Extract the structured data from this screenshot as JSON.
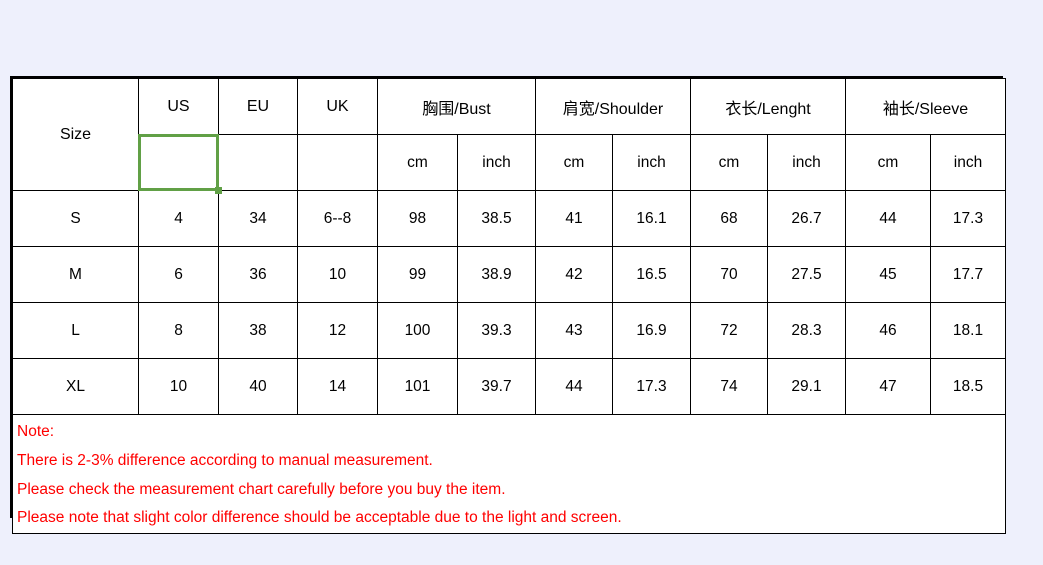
{
  "page": {
    "background_color": "#eef0fc",
    "table_border_color": "#000000",
    "selection_color": "#61a046",
    "note_color": "#ff0000"
  },
  "table": {
    "header_groups": [
      {
        "label": "Size",
        "span": 1
      },
      {
        "label": "US",
        "span": 1
      },
      {
        "label": "EU",
        "span": 1
      },
      {
        "label": "UK",
        "span": 1
      },
      {
        "label": "胸围/Bust",
        "span": 2
      },
      {
        "label": "肩宽/Shoulder",
        "span": 2
      },
      {
        "label": "衣长/Lenght",
        "span": 2
      },
      {
        "label": "袖长/Sleeve",
        "span": 2
      }
    ],
    "unit_row": {
      "size": "",
      "us": "",
      "eu": "",
      "uk": "",
      "bust_cm": "cm",
      "bust_inch": "inch",
      "shoulder_cm": "cm",
      "shoulder_inch": "inch",
      "length_cm": "cm",
      "length_inch": "inch",
      "sleeve_cm": "cm",
      "sleeve_inch": "inch"
    },
    "selected_cell": "us-unit-cell",
    "columns": [
      "Size",
      "US",
      "EU",
      "UK",
      "Bust cm",
      "Bust inch",
      "Shoulder cm",
      "Shoulder inch",
      "Length cm",
      "Length inch",
      "Sleeve cm",
      "Sleeve inch"
    ],
    "rows": [
      {
        "size": "S",
        "us": "4",
        "eu": "34",
        "uk": "6--8",
        "bust_cm": "98",
        "bust_inch": "38.5",
        "shoulder_cm": "41",
        "shoulder_inch": "16.1",
        "length_cm": "68",
        "length_inch": "26.7",
        "sleeve_cm": "44",
        "sleeve_inch": "17.3"
      },
      {
        "size": "M",
        "us": "6",
        "eu": "36",
        "uk": "10",
        "bust_cm": "99",
        "bust_inch": "38.9",
        "shoulder_cm": "42",
        "shoulder_inch": "16.5",
        "length_cm": "70",
        "length_inch": "27.5",
        "sleeve_cm": "45",
        "sleeve_inch": "17.7"
      },
      {
        "size": "L",
        "us": "8",
        "eu": "38",
        "uk": "12",
        "bust_cm": "100",
        "bust_inch": "39.3",
        "shoulder_cm": "43",
        "shoulder_inch": "16.9",
        "length_cm": "72",
        "length_inch": "28.3",
        "sleeve_cm": "46",
        "sleeve_inch": "18.1"
      },
      {
        "size": "XL",
        "us": "10",
        "eu": "40",
        "uk": "14",
        "bust_cm": "101",
        "bust_inch": "39.7",
        "shoulder_cm": "44",
        "shoulder_inch": "17.3",
        "length_cm": "74",
        "length_inch": "29.1",
        "sleeve_cm": "47",
        "sleeve_inch": "18.5"
      }
    ]
  },
  "note": {
    "lines": [
      "Note:",
      "There is 2-3%  difference according to manual measurement.",
      "Please check the measurement chart carefully before you buy the item.",
      "Please note that slight color difference should be acceptable due to the light and screen."
    ]
  }
}
